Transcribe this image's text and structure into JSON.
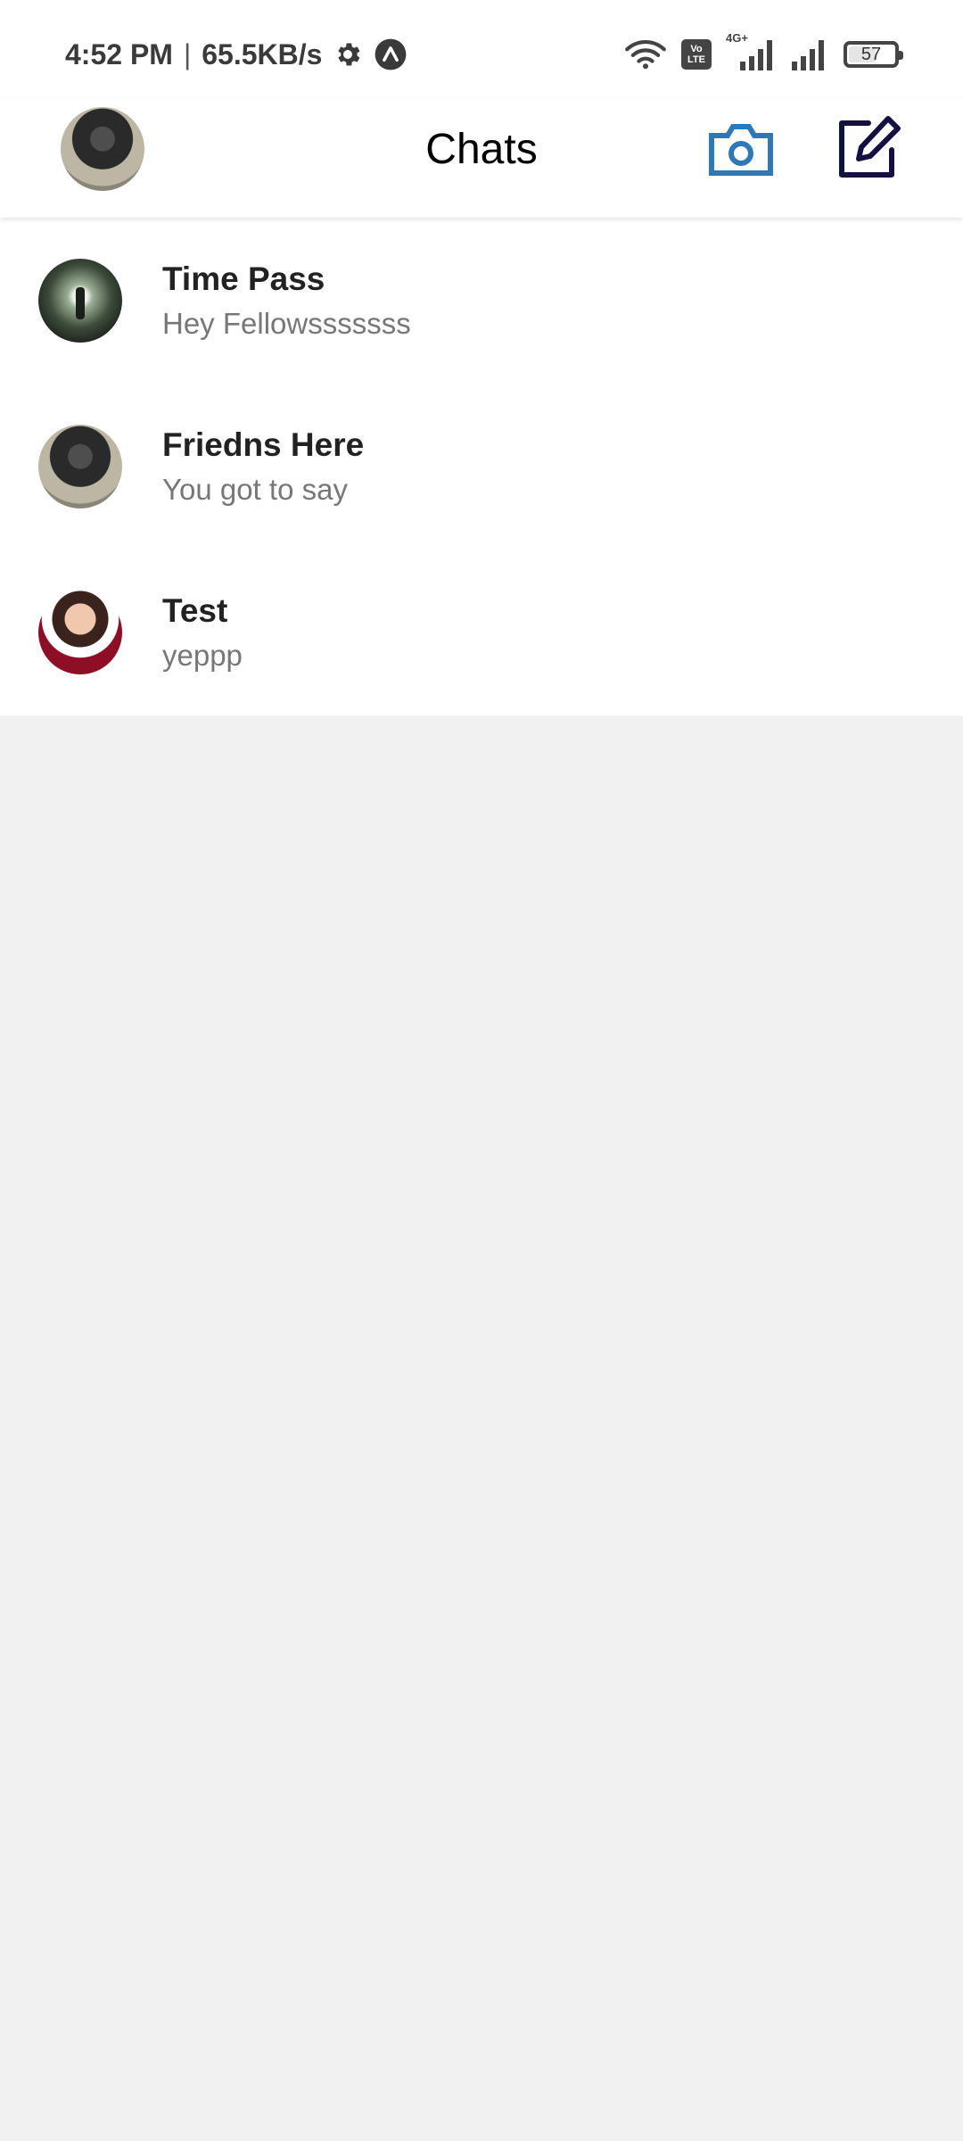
{
  "status_bar": {
    "time": "4:52 PM",
    "separator": "|",
    "network_speed": "65.5KB/s",
    "volte_top": "Vo",
    "volte_bottom": "LTE",
    "network_type": "4G+",
    "battery_level": "57",
    "battery_fraction": 0.57
  },
  "header": {
    "title": "Chats",
    "camera_icon_color": "#2f78b7",
    "compose_icon_color": "#14103f"
  },
  "chats": [
    {
      "name": "Time Pass",
      "preview": "Hey Fellowsssssss"
    },
    {
      "name": "Friedns Here",
      "preview": "You got to say"
    },
    {
      "name": "Test",
      "preview": "yeppp"
    }
  ]
}
